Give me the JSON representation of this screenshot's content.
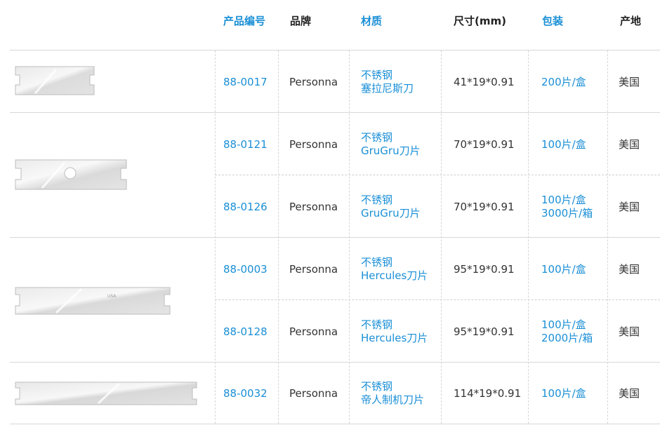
{
  "headers": {
    "code": "产品编号",
    "brand": "品牌",
    "material": "材质",
    "size": "尺寸(mm)",
    "package": "包装",
    "origin": "产地"
  },
  "colors": {
    "accent": "#1a8fd6",
    "text": "#333333",
    "rule": "#d8d8d8"
  },
  "rows": [
    {
      "code": "88-0017",
      "brand": "Personna",
      "material": [
        "不锈钢",
        "塞拉尼斯刀"
      ],
      "size": "41*19*0.91",
      "package": [
        "200片/盒"
      ],
      "origin": "美国"
    },
    {
      "code": "88-0121",
      "brand": "Personna",
      "material": [
        "不锈钢",
        "GruGru刀片"
      ],
      "size": "70*19*0.91",
      "package": [
        "100片/盒"
      ],
      "origin": "美国"
    },
    {
      "code": "88-0126",
      "brand": "Personna",
      "material": [
        "不锈钢",
        "GruGru刀片"
      ],
      "size": "70*19*0.91",
      "package": [
        "100片/盒",
        "3000片/箱"
      ],
      "origin": "美国"
    },
    {
      "code": "88-0003",
      "brand": "Personna",
      "material": [
        "不锈钢",
        "Hercules刀片"
      ],
      "size": "95*19*0.91",
      "package": [
        "100片/盒"
      ],
      "origin": "美国"
    },
    {
      "code": "88-0128",
      "brand": "Personna",
      "material": [
        "不锈钢",
        "Hercules刀片"
      ],
      "size": "95*19*0.91",
      "package": [
        "100片/盒",
        "2000片/箱"
      ],
      "origin": "美国"
    },
    {
      "code": "88-0032",
      "brand": "Personna",
      "material": [
        "不锈钢",
        "帝人制机刀片"
      ],
      "size": "114*19*0.91",
      "package": [
        "100片/盒"
      ],
      "origin": "美国"
    }
  ],
  "blade_images": [
    {
      "name": "blade-short-image",
      "stamp": ""
    },
    {
      "name": "blade-gru-image",
      "stamp": ""
    },
    {
      "name": "blade-hercules-image",
      "stamp": "USA"
    },
    {
      "name": "blade-long-image",
      "stamp": ""
    }
  ]
}
